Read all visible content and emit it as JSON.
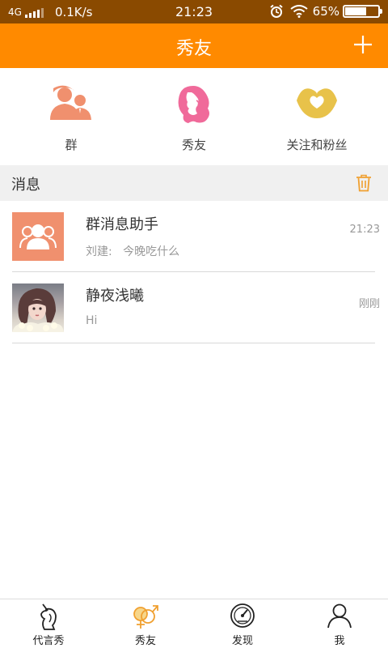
{
  "status_bar": {
    "network": "4G",
    "speed": "0.1K/s",
    "time": "21:23",
    "battery": "65%",
    "battery_level": 0.65
  },
  "header": {
    "title": "秀友",
    "add_icon": "plus-icon"
  },
  "categories": [
    {
      "label": "群",
      "icon": "group-icon",
      "color": "#f0906e"
    },
    {
      "label": "秀友",
      "icon": "female-profile-icon",
      "color": "#f06a9a"
    },
    {
      "label": "关注和粉丝",
      "icon": "lips-heart-icon",
      "color": "#e8c24a"
    }
  ],
  "messages_section": {
    "label": "消息",
    "trash_icon": "trash-icon",
    "trash_color": "#f0a030"
  },
  "messages": [
    {
      "name": "群消息助手",
      "preview": "刘建:   今晚吃什么",
      "time": "21:23",
      "avatar": "group-avatar-icon"
    },
    {
      "name": "静夜浅曦",
      "preview": "Hi",
      "time": "刚刚",
      "avatar": "user-photo"
    }
  ],
  "bottom_nav": [
    {
      "label": "代言秀",
      "icon": "unicorn-icon"
    },
    {
      "label": "秀友",
      "icon": "gender-symbols-icon",
      "active": true
    },
    {
      "label": "发现",
      "icon": "compass-gauge-icon"
    },
    {
      "label": "我",
      "icon": "person-icon"
    }
  ],
  "colors": {
    "brand_orange": "#ff8a00",
    "status_bar": "#8a4a00",
    "section_bg": "#f0f0f0"
  }
}
